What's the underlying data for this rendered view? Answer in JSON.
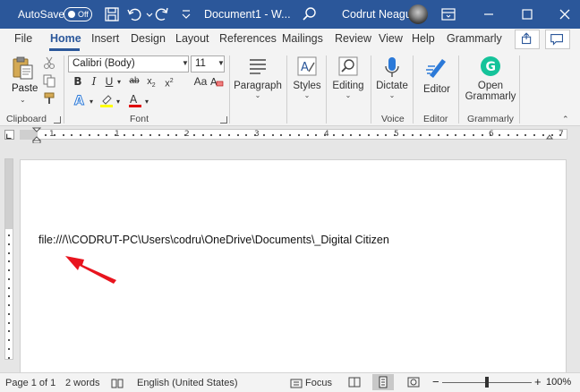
{
  "titlebar": {
    "autosave_label": "AutoSave",
    "autosave_state": "Off",
    "doc_title": "Document1 - W...",
    "user_name": "Codrut Neagu"
  },
  "ribbon_tabs": [
    "File",
    "Home",
    "Insert",
    "Design",
    "Layout",
    "References",
    "Mailings",
    "Review",
    "View",
    "Help",
    "Grammarly"
  ],
  "active_tab": "Home",
  "clipboard": {
    "paste_label": "Paste",
    "group_label": "Clipboard"
  },
  "font": {
    "family": "Calibri (Body)",
    "size": "11",
    "group_label": "Font"
  },
  "paragraph": {
    "label": "Paragraph"
  },
  "styles": {
    "label": "Styles"
  },
  "editing": {
    "label": "Editing"
  },
  "voice": {
    "dictate_label": "Dictate",
    "group_label": "Voice"
  },
  "editor": {
    "label": "Editor",
    "group_label": "Editor"
  },
  "grammarly": {
    "label_line1": "Open",
    "label_line2": "Grammarly",
    "group_label": "Grammarly"
  },
  "ruler": {
    "numbers": [
      "1",
      "1",
      "2",
      "3",
      "4",
      "5",
      "6",
      "7"
    ]
  },
  "document": {
    "text": "file:///\\\\CODRUT-PC\\Users\\codru\\OneDrive\\Documents\\_Digital Citizen"
  },
  "statusbar": {
    "page": "Page 1 of 1",
    "words": "2 words",
    "language": "English (United States)",
    "focus": "Focus",
    "zoom": "100%",
    "zoom_minus": "−",
    "zoom_plus": "+"
  },
  "colors": {
    "accent": "#2b579a",
    "highlight": "#ffff00",
    "font_color": "#e00000",
    "annotation_arrow": "#e8141e",
    "grammarly": "#15c39a"
  },
  "icons": [
    "save-icon",
    "undo-icon",
    "redo-icon",
    "customize-qat-icon",
    "search-icon",
    "ribbon-display-icon",
    "minimize-icon",
    "maximize-icon",
    "close-icon",
    "share-icon",
    "comments-icon",
    "cut-icon",
    "copy-icon",
    "format-painter-icon",
    "microphone-icon",
    "editor-pen-icon",
    "grammarly-icon",
    "read-mode-icon",
    "print-layout-icon",
    "web-layout-icon",
    "focus-icon",
    "proofing-icon"
  ]
}
